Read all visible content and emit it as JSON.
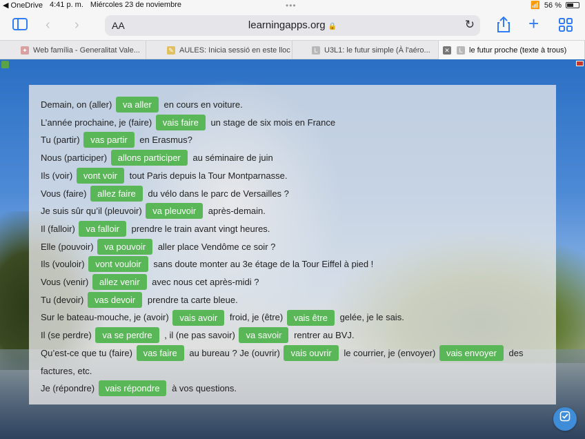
{
  "status": {
    "app": "◀ OneDrive",
    "time": "4:41 p. m.",
    "date": "Miércoles 23 de noviembre",
    "battery": "56 %",
    "battery_level": 0.56
  },
  "toolbar": {
    "text_size": "AA",
    "url": "learningapps.org"
  },
  "tabs": [
    {
      "title": "Web família - Generalitat Vale..."
    },
    {
      "title": "AULES: Inicia sessió en este lloc"
    },
    {
      "title": "U3L1: le futur simple (À l'aéro..."
    },
    {
      "title": "le futur proche (texte à trous)"
    }
  ],
  "exercise": {
    "lines": [
      [
        {
          "t": "Demain, on (aller)"
        },
        {
          "a": "va aller"
        },
        {
          "t": "en cours en voiture."
        }
      ],
      [
        {
          "t": "L’année prochaine, je (faire)"
        },
        {
          "a": "vais faire"
        },
        {
          "t": "un stage de six mois en France"
        }
      ],
      [
        {
          "t": "Tu (partir)"
        },
        {
          "a": "vas partir"
        },
        {
          "t": "en Erasmus?"
        }
      ],
      [
        {
          "t": "Nous (participer)"
        },
        {
          "a": "allons participer"
        },
        {
          "t": "au séminaire de juin"
        }
      ],
      [
        {
          "t": "Ils (voir)"
        },
        {
          "a": "vont voir"
        },
        {
          "t": "tout Paris depuis la Tour Montparnasse."
        }
      ],
      [
        {
          "t": "Vous (faire)"
        },
        {
          "a": "allez faire"
        },
        {
          "t": "du vélo dans le parc de Versailles ?"
        }
      ],
      [
        {
          "t": "Je suis sûr qu’il (pleuvoir)"
        },
        {
          "a": "va pleuvoir"
        },
        {
          "t": "après-demain."
        }
      ],
      [
        {
          "t": "Il (falloir)"
        },
        {
          "a": "va falloir"
        },
        {
          "t": "prendre le train avant vingt heures."
        }
      ],
      [
        {
          "t": "Elle (pouvoir)"
        },
        {
          "a": "va pouvoir"
        },
        {
          "t": "aller place Vendôme ce soir ?"
        }
      ],
      [
        {
          "t": "Ils (vouloir)"
        },
        {
          "a": "vont vouloir"
        },
        {
          "t": "sans doute monter au 3e étage de la Tour Eiffel à pied !"
        }
      ],
      [
        {
          "t": "Vous (venir)"
        },
        {
          "a": "allez venir"
        },
        {
          "t": "avec nous cet après-midi ?"
        }
      ],
      [
        {
          "t": "Tu (devoir)"
        },
        {
          "a": "vas devoir"
        },
        {
          "t": "prendre ta carte bleue."
        }
      ],
      [
        {
          "t": "Sur le bateau-mouche, je (avoir)"
        },
        {
          "a": "vais avoir"
        },
        {
          "t": "froid, je (être)"
        },
        {
          "a": "vais être"
        },
        {
          "t": "gelée, je le sais."
        }
      ],
      [
        {
          "t": "Il (se perdre)"
        },
        {
          "a": "va se perdre"
        },
        {
          "t": ", il (ne pas savoir)"
        },
        {
          "a": "va savoir"
        },
        {
          "t": "rentrer au BVJ."
        }
      ],
      [
        {
          "t": "Qu’est-ce que tu (faire)"
        },
        {
          "a": "vas faire"
        },
        {
          "t": "au bureau ? Je (ouvrir)"
        },
        {
          "a": "vais ouvrir"
        },
        {
          "t": "le courrier, je (envoyer)"
        },
        {
          "a": "vais envoyer"
        },
        {
          "t": "des"
        }
      ],
      [
        {
          "t": "factures, etc."
        }
      ],
      [
        {
          "t": "Je (répondre)"
        },
        {
          "a": "vais répondre"
        },
        {
          "t": "à vos questions."
        }
      ]
    ]
  }
}
